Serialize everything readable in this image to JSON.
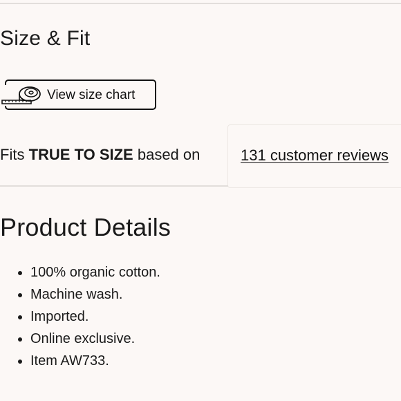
{
  "size_fit": {
    "title": "Size & Fit",
    "size_chart_button": "View size chart",
    "fit_prefix": "Fits ",
    "fit_strong": "TRUE TO SIZE",
    "fit_suffix": " based on",
    "reviews_link": "131 customer reviews"
  },
  "product_details": {
    "title": "Product Details",
    "items": [
      "100% organic cotton.",
      "Machine wash.",
      "Imported.",
      "Online exclusive.",
      "Item AW733."
    ]
  },
  "icons": {
    "size_chart": "measuring-tape-icon"
  }
}
